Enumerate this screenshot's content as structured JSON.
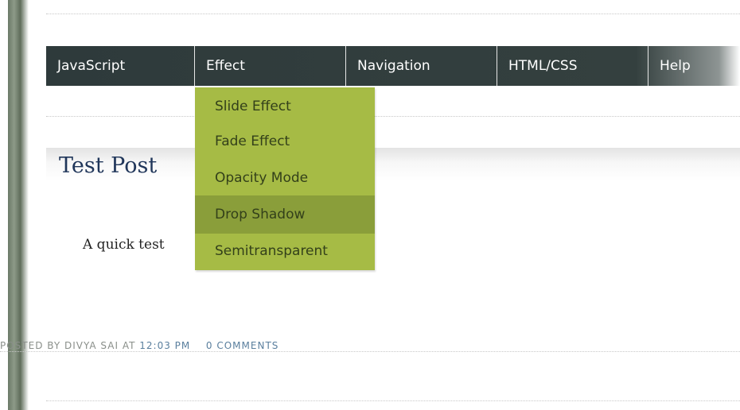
{
  "nav": {
    "items": [
      {
        "label": "JavaScript"
      },
      {
        "label": "Effect"
      },
      {
        "label": "Navigation"
      },
      {
        "label": "HTML/CSS"
      },
      {
        "label": "Help"
      }
    ]
  },
  "dropdown": {
    "items": [
      {
        "label": "Slide Effect"
      },
      {
        "label": "Fade Effect"
      },
      {
        "label": "Opacity Mode"
      },
      {
        "label": "Drop Shadow",
        "hovered": true
      },
      {
        "label": "Semitransparent"
      }
    ]
  },
  "post": {
    "title": "Test Post",
    "body": "A quick test",
    "footer": {
      "posted_by": "POSTED BY DIVYA SAI",
      "at": "AT",
      "time": "12:03 PM",
      "comments": "0 COMMENTS"
    }
  },
  "colors": {
    "nav_bg": "#2e3a3b",
    "dropdown_bg": "#a6bb45",
    "dropdown_hover": "#8a9e3a",
    "title": "#20365a",
    "link": "#5a7f9e"
  }
}
